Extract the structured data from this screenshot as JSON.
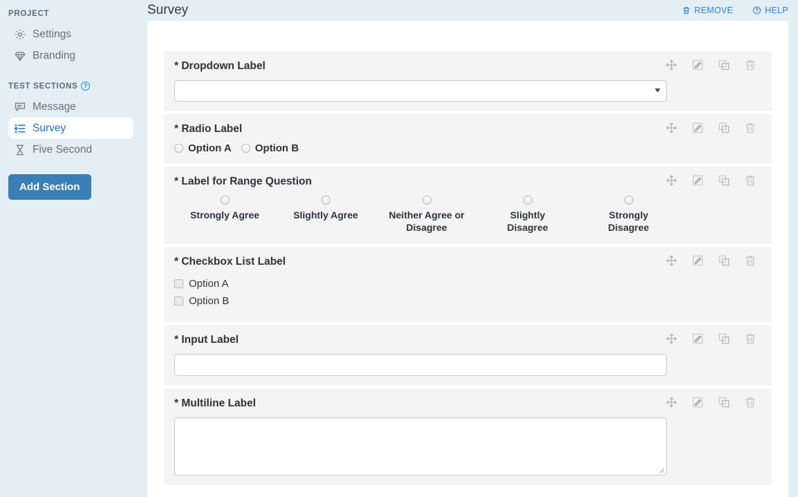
{
  "sidebar": {
    "project_group_label": "PROJECT",
    "test_sections_group_label": "TEST SECTIONS",
    "help_glyph": "?",
    "project_items": [
      {
        "label": "Settings",
        "icon": "gear-icon"
      },
      {
        "label": "Branding",
        "icon": "diamond-icon"
      }
    ],
    "test_section_items": [
      {
        "label": "Message",
        "icon": "message-icon",
        "active": false
      },
      {
        "label": "Survey",
        "icon": "list-icon",
        "active": true
      },
      {
        "label": "Five Second",
        "icon": "hourglass-icon",
        "active": false
      }
    ],
    "add_section_label": "Add Section"
  },
  "header": {
    "title": "Survey",
    "remove_label": "REMOVE",
    "help_label": "HELP"
  },
  "question_actions": {
    "move_label": "Move",
    "edit_label": "Edit",
    "duplicate_label": "Duplicate",
    "delete_label": "Delete"
  },
  "questions": [
    {
      "type": "dropdown",
      "required_mark": "*",
      "label": "Dropdown Label",
      "value": "",
      "options": []
    },
    {
      "type": "radio",
      "required_mark": "*",
      "label": "Radio Label",
      "options": [
        "Option A",
        "Option B"
      ],
      "selected": null
    },
    {
      "type": "range",
      "required_mark": "*",
      "label": "Label for Range Question",
      "options": [
        "Strongly Agree",
        "Slightly Agree",
        "Neither Agree or Disagree",
        "Slightly Disagree",
        "Strongly Disagree"
      ],
      "selected": null
    },
    {
      "type": "checkbox",
      "required_mark": "*",
      "label": "Checkbox List Label",
      "options": [
        "Option A",
        "Option B"
      ],
      "checked": []
    },
    {
      "type": "input",
      "required_mark": "*",
      "label": "Input Label",
      "value": ""
    },
    {
      "type": "multiline",
      "required_mark": "*",
      "label": "Multiline Label",
      "value": ""
    }
  ],
  "colors": {
    "sidebar_bg": "#e3eef5",
    "accent_blue": "#2b7fd4",
    "button_blue": "#3a7fb5",
    "question_bg": "#f4f4f4",
    "card_bg": "#ffffff",
    "text_dark": "#2f3337",
    "text_muted": "#64717a"
  }
}
